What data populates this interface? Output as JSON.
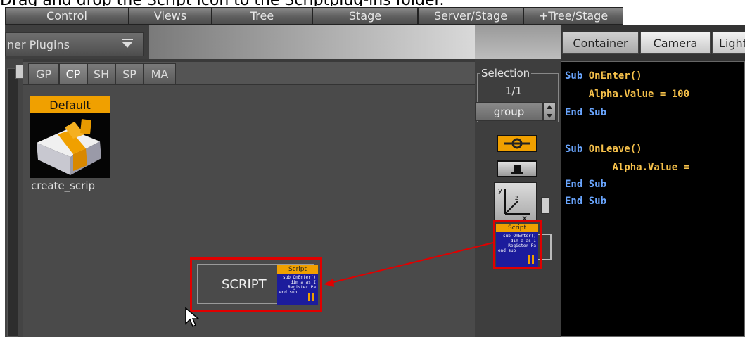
{
  "instruction": "Drag and drop the Script icon to the Scriptplug-ins folder.",
  "top_tabs": [
    "Control",
    "Views",
    "Tree",
    "Stage",
    "Server/Stage",
    "+Tree/Stage"
  ],
  "plugin_selector": {
    "value": "ner Plugins"
  },
  "plugin_tabs": [
    "GP",
    "CP",
    "SH",
    "SP",
    "MA"
  ],
  "active_plugin_tab": "CP",
  "default_item": {
    "label": "Default",
    "name": "create_scrip"
  },
  "drop_target": {
    "label": "SCRIPT"
  },
  "script_icon": {
    "header": "Script",
    "lines": [
      "sub OnEnter()",
      "dim a as I",
      "Register Pa",
      "end sub"
    ]
  },
  "selection": {
    "title": "Selection",
    "count": "1/1",
    "value": "group"
  },
  "right_tabs": [
    "Container",
    "Camera",
    "Light"
  ],
  "code": [
    {
      "kw": "Sub ",
      "rest": "OnEnter()"
    },
    {
      "kw": "",
      "rest": "    Alpha.Value = 100"
    },
    {
      "kw": "End Sub",
      "rest": ""
    },
    {
      "kw": "",
      "rest": ""
    },
    {
      "kw": "Sub ",
      "rest": "OnLeave()"
    },
    {
      "kw": "",
      "rest": "        Alpha.Value ="
    },
    {
      "kw": "End Sub",
      "rest": ""
    },
    {
      "kw": "End Sub",
      "rest": ""
    }
  ],
  "colors": {
    "accent_orange": "#f0a000",
    "highlight_red": "#e00000",
    "code_keyword": "#6aa6ff",
    "code_text": "#f5c04a"
  },
  "icons": [
    "gift-icon",
    "script-icon",
    "axes-icon",
    "camera-icon",
    "mouse-pointer-icon"
  ]
}
